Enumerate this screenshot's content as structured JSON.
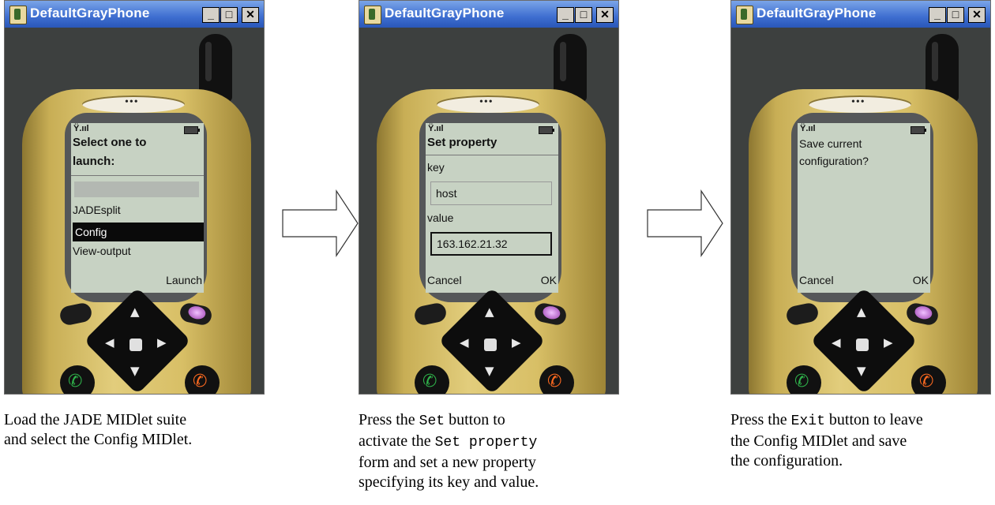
{
  "window": {
    "title": "DefaultGrayPhone",
    "min_label": "_",
    "max_label": "□",
    "close_label": "✕"
  },
  "screens": [
    {
      "status": "Ÿ.ııl",
      "heading_line1": "Select one to",
      "heading_line2": "launch:",
      "items": [
        "JADEsplit",
        "Config",
        "View-output"
      ],
      "selected": "Config",
      "soft_right": "Launch"
    },
    {
      "status": "Ÿ.ııl",
      "heading": "Set property",
      "key_label": "key",
      "key_value": "host",
      "value_label": "value",
      "value_value": "163.162.21.32",
      "soft_left": "Cancel",
      "soft_right": "OK"
    },
    {
      "status": "Ÿ.ııl",
      "message_line1": "Save current",
      "message_line2": "configuration?",
      "soft_left": "Cancel",
      "soft_right": "OK"
    }
  ],
  "captions": {
    "c1_l1": "Load the JADE MIDlet suite",
    "c1_l2": "and select the Config MIDlet.",
    "c2_l1a": "Press the ",
    "c2_l1b": "Set",
    "c2_l1c": " button to",
    "c2_l2a": "activate the ",
    "c2_l2b": "Set property",
    "c2_l3": "form and set a new property",
    "c2_l4": "specifying its key and value.",
    "c3_l1a": "Press the ",
    "c3_l1b": "Exit",
    "c3_l1c": " button to leave",
    "c3_l2": "the Config MIDlet and save",
    "c3_l3": "the configuration."
  }
}
